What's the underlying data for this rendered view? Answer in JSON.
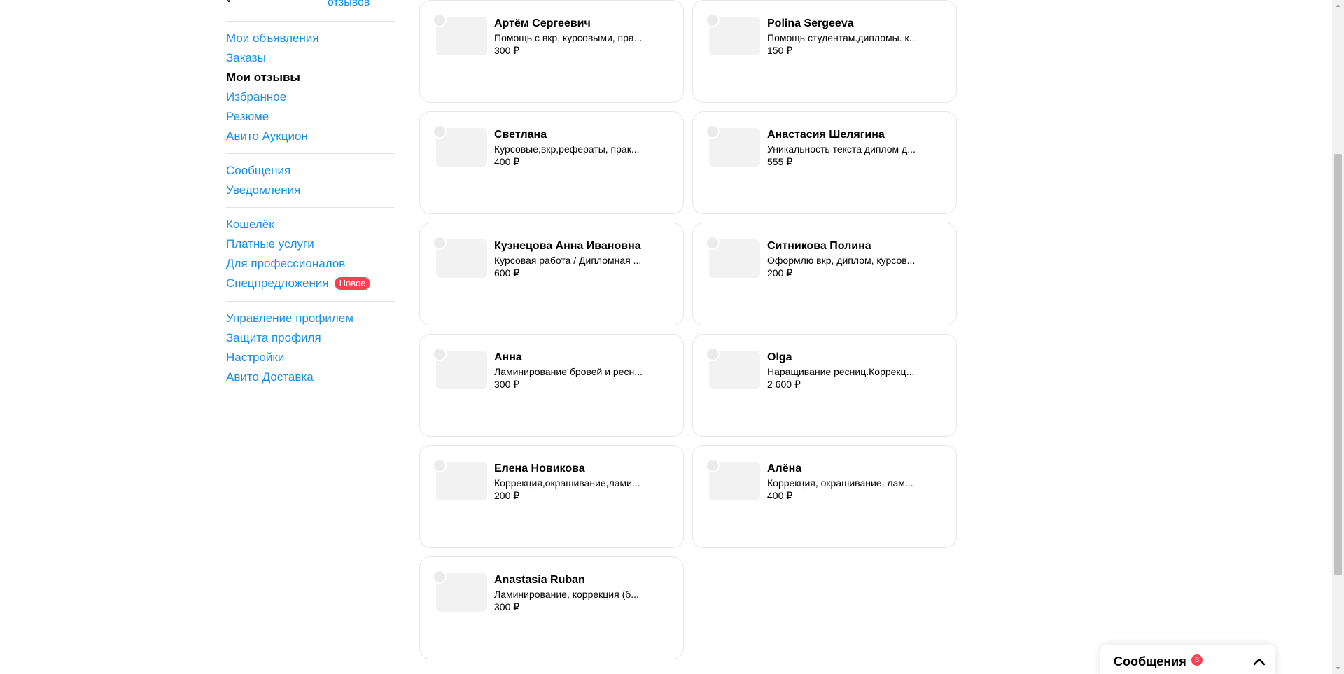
{
  "sidebar": {
    "top_cut_link": "отзывов",
    "groups": [
      [
        "Мои объявления",
        "Заказы",
        "Мои отзывы",
        "Избранное",
        "Резюме",
        "Авито Аукцион"
      ],
      [
        "Сообщения",
        "Уведомления"
      ],
      [
        "Кошелёк",
        "Платные услуги",
        "Для профессионалов",
        "Спецпредложения"
      ],
      [
        "Управление профилем",
        "Защита профиля",
        "Настройки",
        "Авито Доставка"
      ]
    ],
    "active_item": "Мои отзывы",
    "new_badge": "Новое"
  },
  "cards": [
    {
      "name": "Артём Сергеевич",
      "desc": "Помощь с вкр, курсовыми, пра...",
      "price": "300 ₽"
    },
    {
      "name": "Polina Sergeeva",
      "desc": "Помощь студентам.дипломы. к...",
      "price": "150 ₽"
    },
    {
      "name": "Светлана",
      "desc": "Курсовые,вкр,рефераты, прак...",
      "price": "400 ₽"
    },
    {
      "name": "Анастасия Шелягина",
      "desc": "Уникальность текста диплом д...",
      "price": "555 ₽"
    },
    {
      "name": "Кузнецова Анна Ивановна",
      "desc": "Курсовая работа / Дипломная ...",
      "price": "600 ₽"
    },
    {
      "name": "Ситникова Полина",
      "desc": "Оформлю вкр, диплом, курсов...",
      "price": "200 ₽"
    },
    {
      "name": "Анна",
      "desc": "Ламинирование бровей и ресн...",
      "price": "300 ₽"
    },
    {
      "name": "Olga",
      "desc": "Наращивание ресниц.Коррекц...",
      "price": "2 600 ₽"
    },
    {
      "name": "Елена Новикова",
      "desc": "Коррекция,окрашивание,лами...",
      "price": "200 ₽"
    },
    {
      "name": "Алёна",
      "desc": "Коррекция, окрашивание, лам...",
      "price": "400 ₽"
    },
    {
      "name": "Anastasia Ruban",
      "desc": "Ламинирование, коррекция (б...",
      "price": "300 ₽"
    }
  ],
  "messenger": {
    "title": "Сообщения",
    "unread_count": "8"
  },
  "colors": {
    "link": "#1a8fe5",
    "badge": "#ff4053",
    "card_border": "#e6e6e6",
    "placeholder": "#f2f2f2"
  }
}
